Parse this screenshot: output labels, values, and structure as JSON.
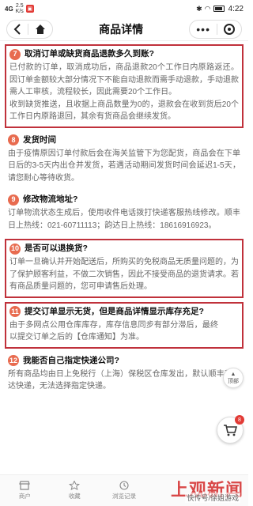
{
  "status_bar": {
    "signal": "4G",
    "speed": "2.5\nK/s",
    "time": "4:22"
  },
  "nav": {
    "title": "商品详情"
  },
  "faqs": [
    {
      "num": "7",
      "question": "取消订单或缺货商品退款多久到账?",
      "answer": "已付款的订单，取消成功后，商品退款20个工作日内原路返还。因订单金额较大部分情况下不能自动退款而需手动退款，手动退款需人工审核，流程较长，因此需要20个工作日。\n收到缺货推送，且收据上商品数量为0的，退款会在收到货后20个工作日内原路退回，其余有货商品会继续发货。"
    },
    {
      "num": "8",
      "question": "发货时间",
      "answer": "由于疫情原因订单付款后会在海关监管下为您配货，商品会在下单日后的3-5天内出仓并发货，若遇活动期间发货时间会延迟1-5天，请您耐心等待收货。"
    },
    {
      "num": "9",
      "question": "修改物流地址?",
      "answer": "订单物流状态生成后，使用收件电话拨打快递客服热线修改。顺丰日上热线：021-60711113；韵达日上热线：18616916923。"
    },
    {
      "num": "10",
      "question": "是否可以退换货?",
      "answer": "订单一旦确认并开始配送后，所购买的免税商品无质量问题的，为了保护顾客利益，不做二次销售，因此不接受商品的退货请求。若有商品质量问题的，您可申请售后处理。"
    },
    {
      "num": "11",
      "question": "提交订单显示无货，但是商品详情显示库存充足?",
      "answer": "由于多网点公用仓库库存，库存信息同步有部分滞后，最终以提交订单之后的【仓库通知】为准。"
    },
    {
      "num": "12",
      "question": "我能否自己指定快递公司?",
      "answer": "所有商品均由日上免税行（上海）保税区仓库发出，默认顺丰和韵达快递，无法选择指定快递。"
    }
  ],
  "floating": {
    "top_label": "顶部",
    "cart_count": "8"
  },
  "tabs": [
    {
      "label": "商户"
    },
    {
      "label": "收藏"
    },
    {
      "label": "浏览记录"
    }
  ],
  "watermark": {
    "main": "上观新闻",
    "sub": "快传号/徐姐游戏"
  }
}
